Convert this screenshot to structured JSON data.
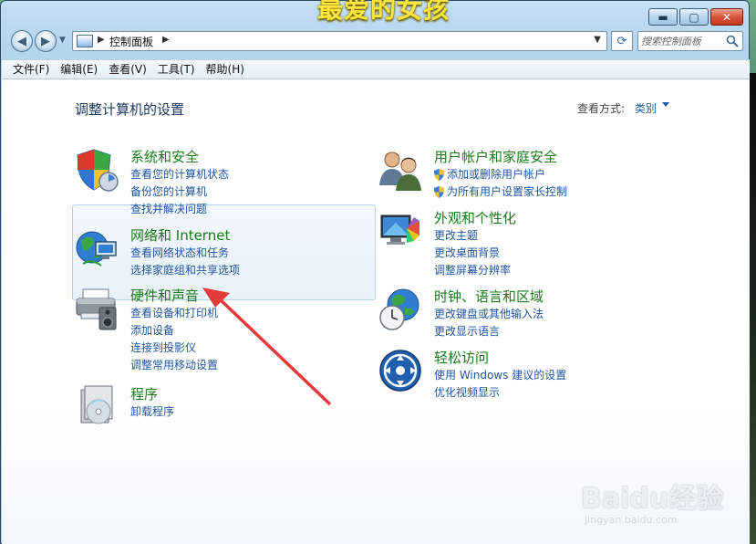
{
  "overlay": {
    "title": "最爱的女孩"
  },
  "window": {
    "controls": {
      "minimize": "▬",
      "maximize": "▢",
      "close": "✕"
    }
  },
  "address_bar": {
    "path": "控制面板",
    "search_placeholder": "搜索控制面板"
  },
  "menu": [
    "文件(F)",
    "编辑(E)",
    "查看(V)",
    "工具(T)",
    "帮助(H)"
  ],
  "main": {
    "title": "调整计算机的设置",
    "view_by_label": "查看方式:",
    "view_by_value": "类别",
    "categories": [
      {
        "title": "系统和安全",
        "icon": "shield-security-icon",
        "links": [
          "查看您的计算机状态",
          "备份您的计算机",
          "查找并解决问题"
        ]
      },
      {
        "title": "网络和 Internet",
        "icon": "network-globe-icon",
        "links": [
          "查看网络状态和任务",
          "选择家庭组和共享选项"
        ]
      },
      {
        "title": "硬件和声音",
        "icon": "printer-speaker-icon",
        "links": [
          "查看设备和打印机",
          "添加设备",
          "连接到投影仪",
          "调整常用移动设置"
        ]
      },
      {
        "title": "程序",
        "icon": "programs-disc-icon",
        "links": [
          "卸载程序"
        ]
      },
      {
        "title": "用户帐户和家庭安全",
        "icon": "users-icon",
        "links": [
          "添加或删除用户帐户",
          "为所有用户设置家长控制"
        ]
      },
      {
        "title": "外观和个性化",
        "icon": "monitor-palette-icon",
        "links": [
          "更改主题",
          "更改桌面背景",
          "调整屏幕分辨率"
        ]
      },
      {
        "title": "时钟、语言和区域",
        "icon": "clock-globe-icon",
        "links": [
          "更改键盘或其他输入法",
          "更改显示语言"
        ]
      },
      {
        "title": "轻松访问",
        "icon": "ease-of-access-icon",
        "links": [
          "使用 Windows 建议的设置",
          "优化视频显示"
        ]
      }
    ]
  },
  "watermark": {
    "brand": "Baidu经验",
    "url": "jingyan.baidu.com"
  },
  "colors": {
    "category_title": "#1a7a1a",
    "link": "#1f55a3",
    "annotation_arrow": "#e53a3a"
  }
}
